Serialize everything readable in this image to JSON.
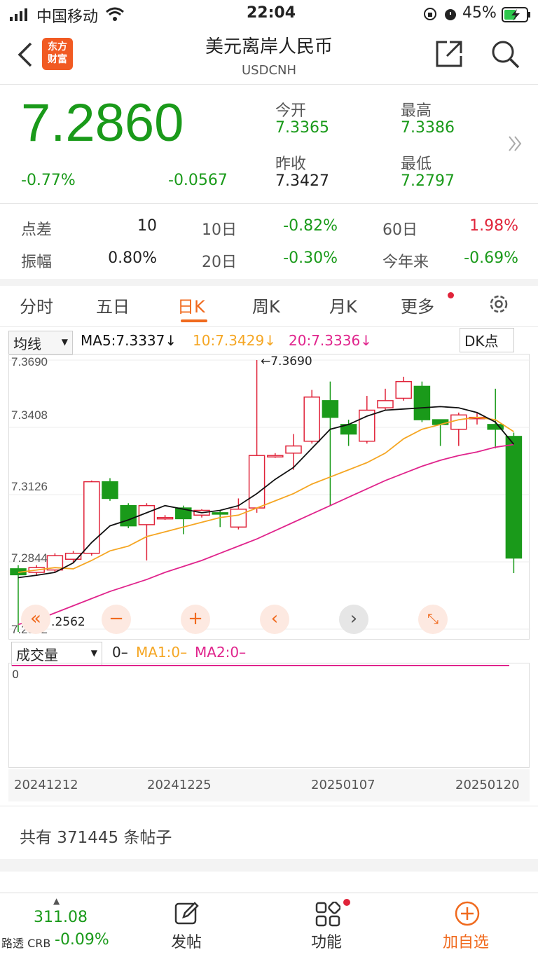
{
  "status": {
    "carrier": "中国移动",
    "time": "22:04",
    "battery": "45%"
  },
  "header": {
    "logo_text": "东方财富",
    "title": "美元离岸人民币",
    "code": "USDCNH"
  },
  "quote": {
    "price": "7.2860",
    "change_pct": "-0.77%",
    "change": "-0.0567",
    "open_label": "今开",
    "open": "7.3365",
    "high_label": "最高",
    "high": "7.3386",
    "prev_label": "昨收",
    "prev": "7.3427",
    "low_label": "最低",
    "low": "7.2797"
  },
  "stats": {
    "row1": [
      {
        "label": "点差",
        "value": "10"
      },
      {
        "label": "10日",
        "value": "-0.82%"
      },
      {
        "label": "60日",
        "value": "1.98%"
      }
    ],
    "row2": [
      {
        "label": "振幅",
        "value": "0.80%"
      },
      {
        "label": "20日",
        "value": "-0.30%"
      },
      {
        "label": "今年来",
        "value": "-0.69%"
      }
    ]
  },
  "tabs": [
    "分时",
    "五日",
    "日K",
    "周K",
    "月K",
    "更多"
  ],
  "indicators": {
    "ma_select": "均线",
    "ma5": "MA5:7.3337↓",
    "ma10": "10:7.3429↓",
    "ma20": "20:7.3336↓",
    "dk": "DK点"
  },
  "colors": {
    "up": "#e0243a",
    "down": "#1a9a1a",
    "ma5": "#111111",
    "ma10": "#f5a623",
    "ma20": "#e0248c",
    "accent": "#f06a1e"
  },
  "chart_data": {
    "type": "candlestick",
    "yticks": [
      "7.3690",
      "7.3408",
      "7.3126",
      "7.2844",
      "7.2562"
    ],
    "ylim": [
      7.2562,
      7.369
    ],
    "max_label": "←7.3690",
    "min_label": "←7.2562",
    "xticks": [
      "20241212",
      "20241225",
      "20250107",
      "20250120"
    ],
    "candles": [
      [
        7.2815,
        7.279,
        7.283,
        7.255
      ],
      [
        7.28,
        7.282,
        7.283,
        7.279
      ],
      [
        7.281,
        7.287,
        7.288,
        7.28
      ],
      [
        7.2855,
        7.288,
        7.289,
        7.284
      ],
      [
        7.288,
        7.318,
        7.3185,
        7.287
      ],
      [
        7.318,
        7.311,
        7.3195,
        7.31
      ],
      [
        7.308,
        7.2995,
        7.309,
        7.2985
      ],
      [
        7.3,
        7.308,
        7.309,
        7.285
      ],
      [
        7.303,
        7.303,
        7.304,
        7.302
      ],
      [
        7.307,
        7.3025,
        7.308,
        7.296
      ],
      [
        7.304,
        7.306,
        7.3065,
        7.303
      ],
      [
        7.305,
        7.3045,
        7.306,
        7.299
      ],
      [
        7.299,
        7.3065,
        7.311,
        7.298
      ],
      [
        7.307,
        7.329,
        7.369,
        7.305
      ],
      [
        7.329,
        7.329,
        7.33,
        7.328
      ],
      [
        7.33,
        7.333,
        7.338,
        7.323
      ],
      [
        7.335,
        7.3535,
        7.3565,
        7.334
      ],
      [
        7.352,
        7.345,
        7.36,
        7.308
      ],
      [
        7.342,
        7.338,
        7.344,
        7.333
      ],
      [
        7.335,
        7.348,
        7.354,
        7.334
      ],
      [
        7.349,
        7.352,
        7.357,
        7.348
      ],
      [
        7.353,
        7.36,
        7.362,
        7.352
      ],
      [
        7.358,
        7.344,
        7.36,
        7.343
      ],
      [
        7.344,
        7.342,
        7.344,
        7.333
      ],
      [
        7.34,
        7.346,
        7.347,
        7.333
      ],
      [
        7.345,
        7.345,
        7.347,
        7.342
      ],
      [
        7.342,
        7.34,
        7.357,
        7.332
      ],
      [
        7.337,
        7.286,
        7.3386,
        7.2797
      ]
    ],
    "ma5": [
      7.2778,
      7.2788,
      7.28,
      7.284,
      7.2925,
      7.2995,
      7.302,
      7.305,
      7.308,
      7.3065,
      7.305,
      7.306,
      7.308,
      7.313,
      7.319,
      7.324,
      7.332,
      7.34,
      7.342,
      7.3455,
      7.348,
      7.3485,
      7.349,
      7.3495,
      7.349,
      7.347,
      7.343,
      7.3337
    ],
    "ma10": [
      7.28,
      7.281,
      7.282,
      7.2815,
      7.285,
      7.289,
      7.291,
      7.295,
      7.297,
      7.299,
      7.301,
      7.303,
      7.304,
      7.307,
      7.31,
      7.313,
      7.317,
      7.32,
      7.323,
      7.326,
      7.33,
      7.336,
      7.34,
      7.342,
      7.344,
      7.345,
      7.344,
      7.339
    ],
    "ma20": [
      7.2582,
      7.26,
      7.263,
      7.266,
      7.269,
      7.272,
      7.2745,
      7.277,
      7.28,
      7.2825,
      7.285,
      7.288,
      7.291,
      7.294,
      7.2975,
      7.301,
      7.3045,
      7.308,
      7.3115,
      7.315,
      7.3185,
      7.3215,
      7.3245,
      7.327,
      7.329,
      7.3305,
      7.3325,
      7.3336
    ]
  },
  "volume": {
    "select": "成交量",
    "v": "0–",
    "ma1": "MA1:0–",
    "ma2": "MA2:0–",
    "axis": "0"
  },
  "posts": {
    "count_text": "共有 371445 条帖子"
  },
  "bottom": {
    "index_val": "311.08",
    "index_name": "路透 CRB",
    "index_chg": "-0.09%",
    "post": "发帖",
    "func": "功能",
    "add": "加自选"
  }
}
